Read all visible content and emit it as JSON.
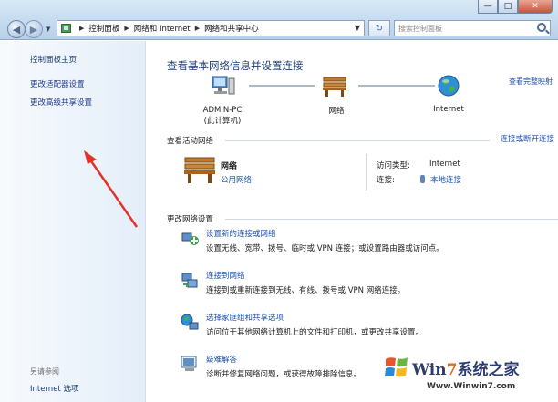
{
  "window": {
    "controls": [
      "—",
      "□",
      "✕"
    ]
  },
  "address_bar": {
    "breadcrumbs": [
      "控制面板",
      "网络和 Internet",
      "网络和共享中心"
    ],
    "search_placeholder": "搜索控制面板"
  },
  "sidebar": {
    "home": "控制面板主页",
    "items": [
      "更改适配器设置",
      "更改高级共享设置"
    ],
    "see_also_label": "另请参阅",
    "see_also_items": [
      "Internet 选项"
    ]
  },
  "main": {
    "title": "查看基本网络信息并设置连接",
    "full_map_link": "查看完整映射",
    "map": {
      "computer_name": "ADMIN-PC",
      "computer_sub": "(此计算机)",
      "network": "网络",
      "internet": "Internet"
    },
    "active_networks_label": "查看活动网络",
    "connect_disconnect_link": "连接或断开连接",
    "active_network": {
      "name": "网络",
      "type": "公用网络",
      "access_type_label": "访问类型:",
      "access_type_value": "Internet",
      "connections_label": "连接:",
      "connections_value": "本地连接"
    },
    "change_settings_label": "更改网络设置",
    "tasks": [
      {
        "title": "设置新的连接或网络",
        "desc": "设置无线、宽带、拨号、临时或 VPN 连接；或设置路由器或访问点。"
      },
      {
        "title": "连接到网络",
        "desc": "连接到或重新连接到无线、有线、拨号或 VPN 网络连接。"
      },
      {
        "title": "选择家庭组和共享选项",
        "desc": "访问位于其他网络计算机上的文件和打印机，或更改共享设置。"
      },
      {
        "title": "疑难解答",
        "desc": "诊断并修复网络问题，或获得故障排除信息。"
      }
    ]
  },
  "watermark": {
    "brand_prefix": "Win",
    "brand_seven": "7",
    "brand_suffix": "系统之家",
    "url": "Www.Winwin7.com"
  },
  "colors": {
    "link": "#1e4fa8",
    "title": "#1e3f75",
    "annotation_arrow": "#e0342b"
  }
}
